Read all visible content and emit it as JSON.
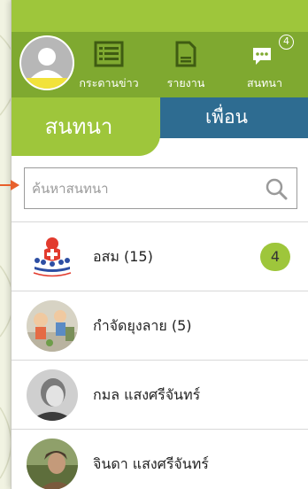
{
  "header": {
    "nav": [
      {
        "label": "กระดานข่าว",
        "icon": "newsboard-icon"
      },
      {
        "label": "รายงาน",
        "icon": "report-icon"
      },
      {
        "label": "สนทนา",
        "icon": "chat-icon",
        "badge": "4"
      }
    ]
  },
  "tabs": {
    "chat": "สนทนา",
    "friends": "เพื่อน"
  },
  "search": {
    "placeholder": "ค้นหาสนทนา",
    "value": ""
  },
  "chats": [
    {
      "name": "อสม (15)",
      "unread": "4",
      "thumb_logo_text": "Primary Health Care"
    },
    {
      "name": "กำจัดยุงลาย (5)"
    },
    {
      "name": "กมล แสงศรีจันทร์"
    },
    {
      "name": "จินดา แสงศรีจันทร์"
    }
  ],
  "colors": {
    "green": "#9ec63b",
    "dark_green": "#7fa930",
    "blue": "#2e6c91",
    "pointer": "#e8602c"
  }
}
